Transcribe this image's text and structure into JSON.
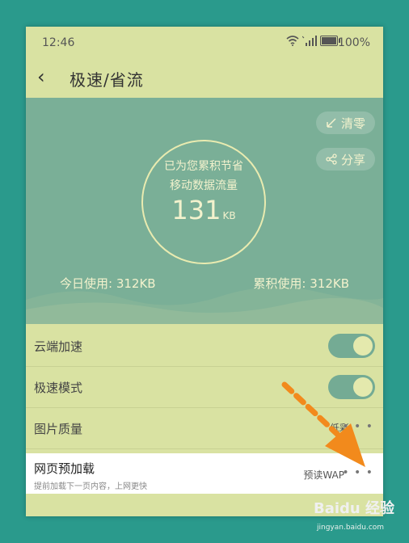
{
  "status_bar": {
    "time": "12:46",
    "battery": "100%"
  },
  "title_bar": {
    "back": "‹",
    "title": "极速/省流"
  },
  "hero": {
    "clear_label": "清零",
    "share_label": "分享",
    "saved_line1": "已为您累积节省",
    "saved_line2": "移动数据流量",
    "saved_value": "131",
    "saved_unit": "KB",
    "today_usage": "今日使用: 312KB",
    "total_usage": "累积使用: 312KB"
  },
  "settings": {
    "cloud_accel": {
      "label": "云端加速",
      "enabled": true
    },
    "speed_mode": {
      "label": "极速模式",
      "enabled": true
    },
    "image_quality": {
      "label": "图片质量",
      "value": "低彩"
    },
    "preload": {
      "label": "网页预加载",
      "description": "提前加载下一页内容，上网更快",
      "value": "预读WAP"
    }
  },
  "more_icon": "• • •",
  "watermark": {
    "brand": "Baidu 经验",
    "url": "jingyan.baidu.com"
  },
  "colors": {
    "background": "#2a9a8c",
    "panel": "#d9e2a2",
    "hero": "#7aaf97",
    "toggle": "#74ab94",
    "arrow": "#f28a1c"
  }
}
